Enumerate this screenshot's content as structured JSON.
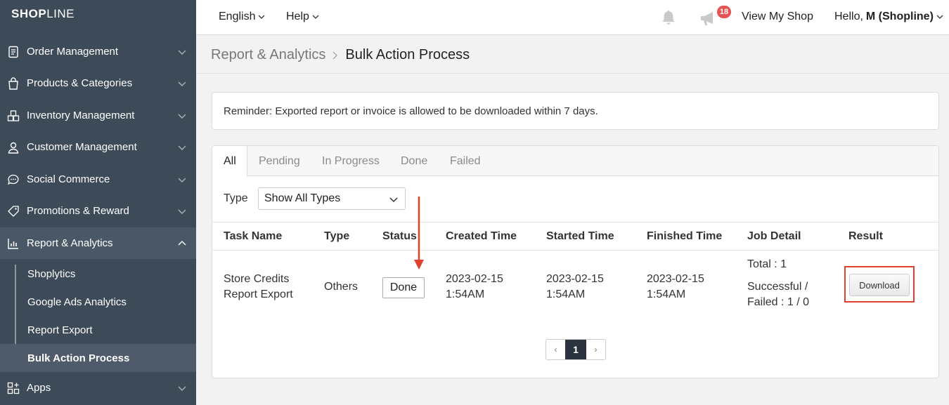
{
  "brand": {
    "logo_bold": "SHOP",
    "logo_rest": "LINE"
  },
  "sidebar": {
    "items": [
      {
        "label": "Order Management",
        "icon": "clipboard-icon"
      },
      {
        "label": "Products & Categories",
        "icon": "shopping-bag-icon"
      },
      {
        "label": "Inventory Management",
        "icon": "boxes-icon"
      },
      {
        "label": "Customer Management",
        "icon": "user-icon"
      },
      {
        "label": "Social Commerce",
        "icon": "chat-bubble-icon"
      },
      {
        "label": "Promotions & Reward",
        "icon": "tag-icon"
      },
      {
        "label": "Report & Analytics",
        "icon": "bar-chart-icon"
      },
      {
        "label": "Apps",
        "icon": "apps-grid-icon"
      }
    ],
    "submenu": [
      {
        "label": "Shoplytics"
      },
      {
        "label": "Google Ads Analytics"
      },
      {
        "label": "Report Export"
      },
      {
        "label": "Bulk Action Process"
      }
    ]
  },
  "topbar": {
    "language": "English",
    "help": "Help",
    "notification_count": "18",
    "view_shop": "View My Shop",
    "greeting": "Hello,",
    "user": "M (Shopline)"
  },
  "breadcrumb": {
    "parent": "Report & Analytics",
    "current": "Bulk Action Process"
  },
  "reminder": "Reminder: Exported report or invoice is allowed to be downloaded within 7 days.",
  "tabs": [
    "All",
    "Pending",
    "In Progress",
    "Done",
    "Failed"
  ],
  "filter": {
    "label": "Type",
    "selected": "Show All Types"
  },
  "table": {
    "headers": [
      "Task Name",
      "Type",
      "Status",
      "Created Time",
      "Started Time",
      "Finished Time",
      "Job Detail",
      "Result"
    ],
    "row": {
      "task_name_1": "Store Credits",
      "task_name_2": "Report Export",
      "type": "Others",
      "status": "Done",
      "created_date": "2023-02-15",
      "created_time": "1:54AM",
      "started_date": "2023-02-15",
      "started_time": "1:54AM",
      "finished_date": "2023-02-15",
      "finished_time": "1:54AM",
      "total": "Total : 1",
      "success_1": "Successful /",
      "success_2": "Failed : 1 / 0",
      "result_button": "Download"
    }
  },
  "pagination": {
    "prev": "‹",
    "current": "1",
    "next": "›"
  },
  "colors": {
    "sidebar": "#3d4a58",
    "highlight": "#e0412c",
    "badge": "#e55353"
  }
}
